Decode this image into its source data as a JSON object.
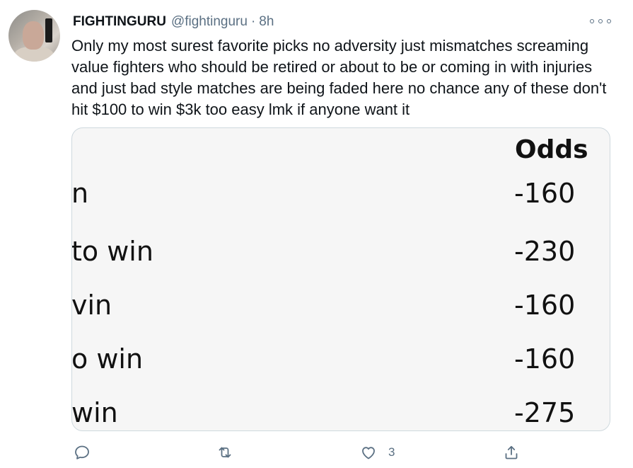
{
  "tweet": {
    "display_name": "FIGHTINGURU",
    "handle": "@fightinguru",
    "separator": "·",
    "time": "8h",
    "text": "Only my most surest favorite picks no adversity just mismatches screaming value fighters who should be retired or about to be or coming in with injuries and just bad style matches are being faded here no chance any of these don't hit $100 to win $3k too easy lmk if anyone want it"
  },
  "media": {
    "odds_header": "Odds",
    "rows": [
      {
        "label": "n",
        "odds": "-160"
      },
      {
        "label": "to win",
        "odds": "-230"
      },
      {
        "label": "vin",
        "odds": "-160"
      },
      {
        "label": "o win",
        "odds": "-160"
      },
      {
        "label": "win",
        "odds": "-275"
      }
    ]
  },
  "actions": {
    "reply_icon": "reply-icon",
    "retweet_icon": "retweet-icon",
    "like_icon": "heart-icon",
    "like_count": "3",
    "share_icon": "share-icon"
  },
  "colors": {
    "secondary_text": "#5b7083",
    "media_background": "#f6f6f6",
    "border": "#cfd9de"
  }
}
